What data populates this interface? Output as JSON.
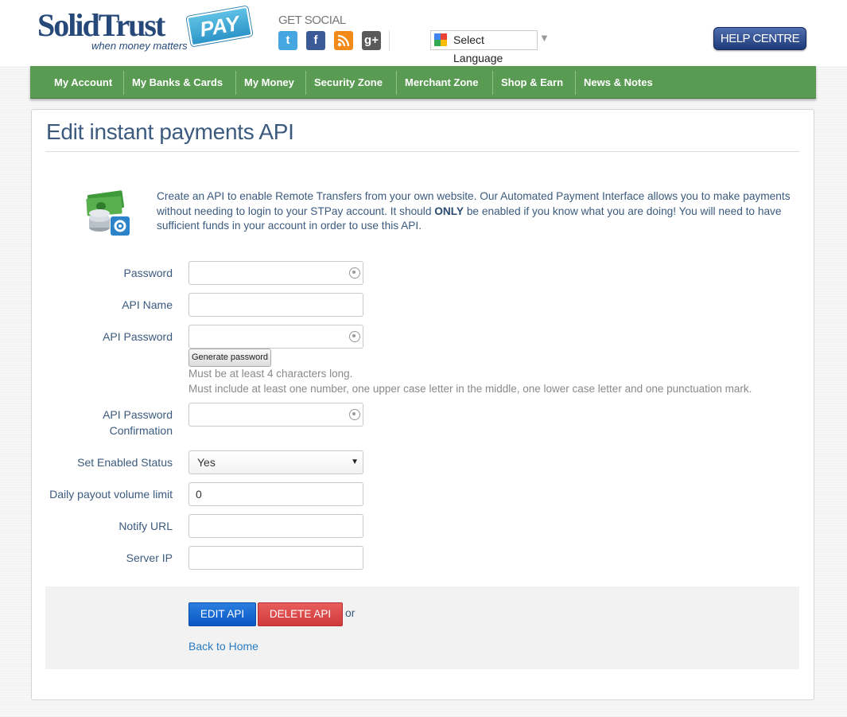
{
  "header": {
    "logo_text": "SolidTrust",
    "logo_badge": "PAY",
    "logo_tagline": "when money matters",
    "social_title": "GET SOCIAL",
    "social_icons": [
      "twitter-icon",
      "facebook-icon",
      "rss-icon",
      "google-plus-icon"
    ],
    "language_label": "Select Language",
    "help_label": "HELP CENTRE"
  },
  "nav": {
    "items": [
      "My Account",
      "My Banks & Cards",
      "My Money",
      "Security Zone",
      "Merchant Zone",
      "Shop & Earn",
      "News & Notes"
    ]
  },
  "page": {
    "title": "Edit instant payments API",
    "intro_part1": "Create an API to enable Remote Transfers from your own website. Our Automated Payment Interface allows you to make payments without needing to login to your STPay account. It should ",
    "intro_bold": "ONLY",
    "intro_part2": " be enabled if you know what you are doing! You will need to have sufficient funds in your account in order to use this API."
  },
  "form": {
    "password_label": "Password",
    "api_name_label": "API Name",
    "api_password_label": "API Password",
    "generate_label": "Generate password",
    "hint_line1": "Must be at least 4 characters long.",
    "hint_line2": "Must include at least one number, one upper case letter in the middle, one lower case letter and one punctuation mark.",
    "api_password_confirm_label_1": "API Password",
    "api_password_confirm_label_2": "Confirmation",
    "enabled_label": "Set Enabled Status",
    "enabled_value": "Yes",
    "daily_limit_label": "Daily payout volume limit",
    "daily_limit_value": "0",
    "notify_url_label": "Notify URL",
    "server_ip_label": "Server IP"
  },
  "actions": {
    "edit_label": "EDIT API",
    "delete_label": "DELETE API",
    "or_text": "or",
    "back_label": "Back to Home"
  },
  "colors": {
    "nav_green": "#5a9b53",
    "title_blue": "#3b5a7e",
    "edit_blue": "#0a56c4",
    "delete_red": "#d03a3a"
  }
}
